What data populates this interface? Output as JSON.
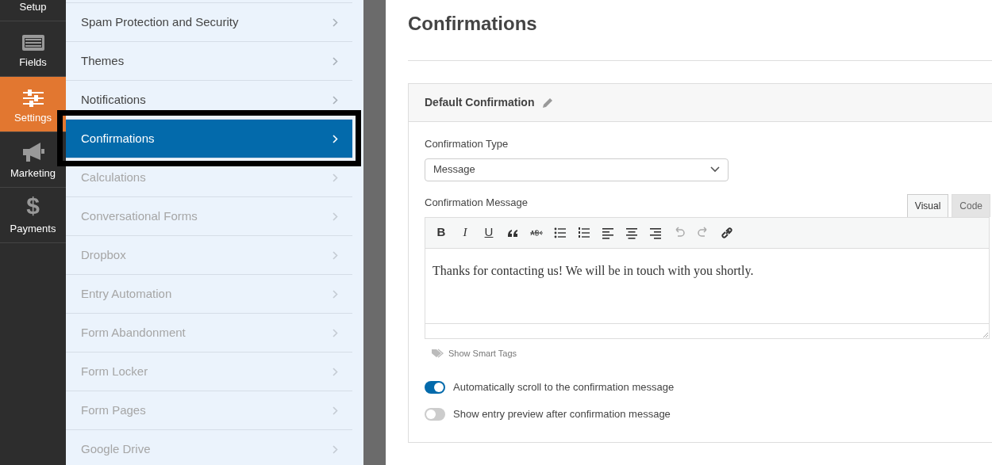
{
  "sidebar": {
    "items": [
      {
        "label": "Setup",
        "selected": false
      },
      {
        "label": "Fields",
        "selected": false
      },
      {
        "label": "Settings",
        "selected": true
      },
      {
        "label": "Marketing",
        "selected": false
      },
      {
        "label": "Payments",
        "glyph": "$",
        "selected": false
      }
    ]
  },
  "settings_menu": {
    "items": [
      {
        "label": "Spam Protection and Security",
        "selected": false,
        "disabled": false,
        "outlined": false
      },
      {
        "label": "Themes",
        "selected": false,
        "disabled": false,
        "outlined": false
      },
      {
        "label": "Notifications",
        "selected": false,
        "disabled": false,
        "outlined": false
      },
      {
        "label": "Confirmations",
        "selected": true,
        "disabled": false,
        "outlined": true
      },
      {
        "label": "Calculations",
        "selected": false,
        "disabled": true,
        "outlined": false
      },
      {
        "label": "Conversational Forms",
        "selected": false,
        "disabled": true,
        "outlined": false
      },
      {
        "label": "Dropbox",
        "selected": false,
        "disabled": true,
        "outlined": false
      },
      {
        "label": "Entry Automation",
        "selected": false,
        "disabled": true,
        "outlined": false
      },
      {
        "label": "Form Abandonment",
        "selected": false,
        "disabled": true,
        "outlined": false
      },
      {
        "label": "Form Locker",
        "selected": false,
        "disabled": true,
        "outlined": false
      },
      {
        "label": "Form Pages",
        "selected": false,
        "disabled": true,
        "outlined": false
      },
      {
        "label": "Google Drive",
        "selected": false,
        "disabled": true,
        "outlined": false
      }
    ]
  },
  "page": {
    "title": "Confirmations",
    "card": {
      "title": "Default Confirmation",
      "type_label": "Confirmation Type",
      "type_value": "Message",
      "message_label": "Confirmation Message",
      "editor_tabs": [
        {
          "label": "Visual",
          "selected": true
        },
        {
          "label": "Code",
          "selected": false
        }
      ],
      "toolbar": [
        {
          "kind": "bold",
          "label": "B",
          "disabled": false
        },
        {
          "kind": "italic",
          "label": "I",
          "disabled": false
        },
        {
          "kind": "underline",
          "label": "U",
          "disabled": false
        },
        {
          "kind": "quote",
          "disabled": false
        },
        {
          "kind": "strike",
          "disabled": false
        },
        {
          "kind": "bullets",
          "disabled": false
        },
        {
          "kind": "numbers",
          "disabled": false
        },
        {
          "kind": "align-left",
          "disabled": false
        },
        {
          "kind": "align-center",
          "disabled": false
        },
        {
          "kind": "align-right",
          "disabled": false
        },
        {
          "kind": "undo",
          "disabled": true
        },
        {
          "kind": "redo",
          "disabled": true
        },
        {
          "kind": "link",
          "disabled": false
        }
      ],
      "message": "Thanks for contacting us! We will be in touch with you shortly.",
      "smart_tags": "Show Smart Tags",
      "toggles": [
        {
          "label": "Automatically scroll to the confirmation message",
          "on": true
        },
        {
          "label": "Show entry preview after confirmation message",
          "on": false
        }
      ]
    }
  }
}
